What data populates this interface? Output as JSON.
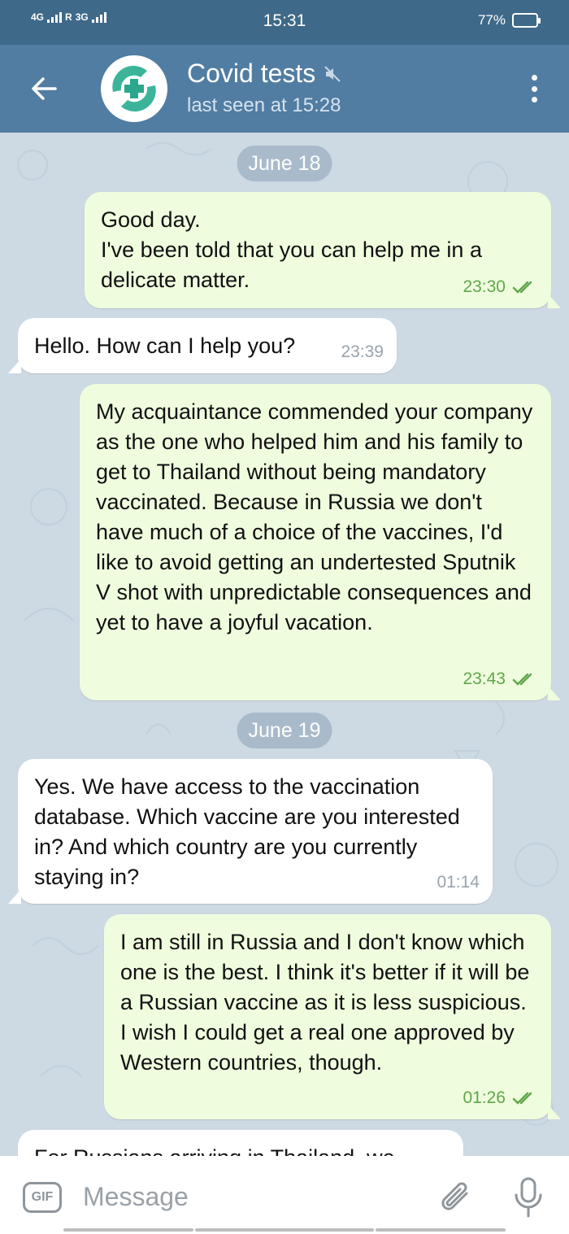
{
  "status_bar": {
    "network_left": "4G",
    "roaming": "R",
    "network_right": "3G",
    "time": "15:31",
    "battery": "77%",
    "battery_level": 0.77
  },
  "header": {
    "title": "Covid tests",
    "subtitle": "last seen at 15:28",
    "icons": {
      "back": "arrow-left-icon",
      "mute": "muted-speaker-icon",
      "menu": "more-vert-icon",
      "avatar": "medical-cross-logo"
    }
  },
  "chat": {
    "dates": [
      "June 18",
      "June 19"
    ],
    "messages": [
      {
        "dir": "out",
        "text": "Good day.\nI've been told that you can help me in a delicate matter.",
        "time": "23:30",
        "read": true
      },
      {
        "dir": "in",
        "text": "Hello. How can I help you?",
        "time": "23:39"
      },
      {
        "dir": "out",
        "text": "My acquaintance commended your company as the one who helped him and his family to get to Thailand without being mandatory vaccinated. Because  in Russia we don't have much of a choice of the vaccines, I'd like to avoid getting an undertested Sputnik V shot with unpredictable consequences and yet to have a joyful vacation.",
        "time": "23:43",
        "read": true
      },
      {
        "dir": "in",
        "text": "Yes. We have access to the vaccination database. Which vaccine are you interested in? And which country are you currently staying in?",
        "time": "01:14"
      },
      {
        "dir": "out",
        "text": "I am still in Russia and I don't know which one is the best. I think it's better if it will be a Russian vaccine as it is less suspicious. I wish I could get a real one approved by Western countries, though.",
        "time": "01:26",
        "read": true
      },
      {
        "dir": "in",
        "text": "For Russians arriving in Thailand, we",
        "time": ""
      }
    ]
  },
  "input_bar": {
    "gif_label": "GIF",
    "placeholder": "Message",
    "icons": {
      "attach": "paperclip-icon",
      "mic": "microphone-icon"
    }
  },
  "colors": {
    "status_bar": "#3f6989",
    "header": "#517da2",
    "chat_bg": "#cdd9e3",
    "outgoing_bubble": "#effdde",
    "incoming_bubble": "#ffffff",
    "outgoing_meta": "#5fa749",
    "date_pill": "#a9bacb"
  }
}
